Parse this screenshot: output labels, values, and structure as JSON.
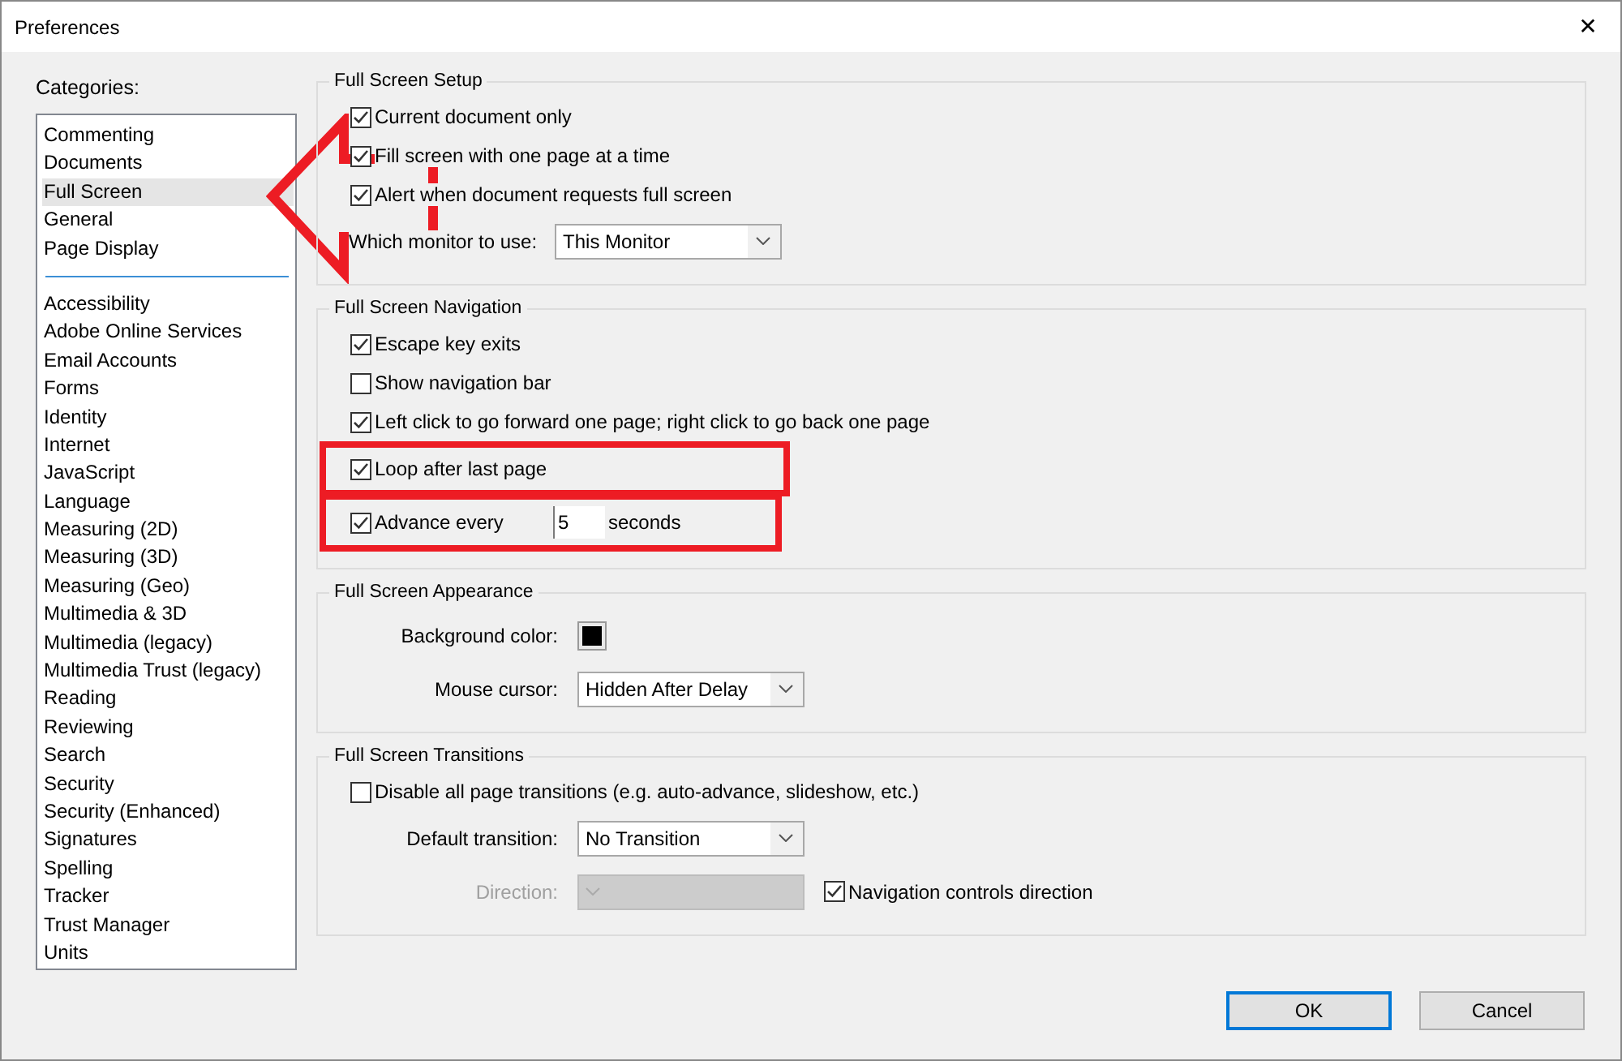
{
  "window": {
    "title": "Preferences",
    "close": "✕"
  },
  "categories": {
    "label": "Categories:",
    "sections": [
      [
        {
          "label": "Commenting",
          "selected": false
        },
        {
          "label": "Documents",
          "selected": false
        },
        {
          "label": "Full Screen",
          "selected": true
        },
        {
          "label": "General",
          "selected": false
        },
        {
          "label": "Page Display",
          "selected": false
        }
      ],
      [
        {
          "label": "Accessibility",
          "selected": false
        },
        {
          "label": "Adobe Online Services",
          "selected": false
        },
        {
          "label": "Email Accounts",
          "selected": false
        },
        {
          "label": "Forms",
          "selected": false
        },
        {
          "label": "Identity",
          "selected": false
        },
        {
          "label": "Internet",
          "selected": false
        },
        {
          "label": "JavaScript",
          "selected": false
        },
        {
          "label": "Language",
          "selected": false
        },
        {
          "label": "Measuring (2D)",
          "selected": false
        },
        {
          "label": "Measuring (3D)",
          "selected": false
        },
        {
          "label": "Measuring (Geo)",
          "selected": false
        },
        {
          "label": "Multimedia & 3D",
          "selected": false
        },
        {
          "label": "Multimedia (legacy)",
          "selected": false
        },
        {
          "label": "Multimedia Trust (legacy)",
          "selected": false
        },
        {
          "label": "Reading",
          "selected": false
        },
        {
          "label": "Reviewing",
          "selected": false
        },
        {
          "label": "Search",
          "selected": false
        },
        {
          "label": "Security",
          "selected": false
        },
        {
          "label": "Security (Enhanced)",
          "selected": false
        },
        {
          "label": "Signatures",
          "selected": false
        },
        {
          "label": "Spelling",
          "selected": false
        },
        {
          "label": "Tracker",
          "selected": false
        },
        {
          "label": "Trust Manager",
          "selected": false
        },
        {
          "label": "Units",
          "selected": false
        }
      ]
    ]
  },
  "groups": [
    {
      "title": "Full Screen Setup",
      "rows": [
        {
          "kind": "checkbox",
          "label": "Current document only",
          "checked": true
        },
        {
          "kind": "checkbox",
          "label": "Fill screen with one page at a time",
          "checked": true
        },
        {
          "kind": "checkbox",
          "label": "Alert when document requests full screen",
          "checked": true
        },
        {
          "kind": "dropdown",
          "label": "Which monitor to use:",
          "value": "This Monitor",
          "disabled": false
        }
      ]
    },
    {
      "title": "Full Screen Navigation",
      "rows": [
        {
          "kind": "checkbox",
          "label": "Escape key exits",
          "checked": true,
          "highlighted": false
        },
        {
          "kind": "checkbox",
          "label": "Show navigation bar",
          "checked": false,
          "highlighted": false
        },
        {
          "kind": "checkbox",
          "label": "Left click to go forward one page; right click to go back one page",
          "checked": true,
          "highlighted": false
        },
        {
          "kind": "checkbox",
          "label": "Loop after last page",
          "checked": true,
          "highlighted": true
        },
        {
          "kind": "number",
          "label": "Advance every",
          "checked": true,
          "value": "5",
          "unit": "seconds",
          "highlighted": true
        }
      ]
    },
    {
      "title": "Full Screen Appearance",
      "rows": [
        {
          "kind": "color",
          "label": "Background color:",
          "color": "#000000"
        },
        {
          "kind": "dropdown",
          "label": "Mouse cursor:",
          "value": "Hidden After Delay",
          "disabled": false
        }
      ]
    },
    {
      "title": "Full Screen Transitions",
      "rows": [
        {
          "kind": "checkbox",
          "label": "Disable all page transitions (e.g. auto-advance, slideshow, etc.)",
          "checked": false
        },
        {
          "kind": "dropdown",
          "label": "Default transition:",
          "value": "No Transition",
          "disabled": false
        },
        {
          "kind": "dropdown",
          "label": "Direction:",
          "disabled": true,
          "extra": {
            "label": "Navigation controls direction",
            "checked": true
          }
        }
      ]
    }
  ],
  "buttons": [
    {
      "label": "OK",
      "default": true
    },
    {
      "label": "Cancel",
      "default": false
    }
  ]
}
